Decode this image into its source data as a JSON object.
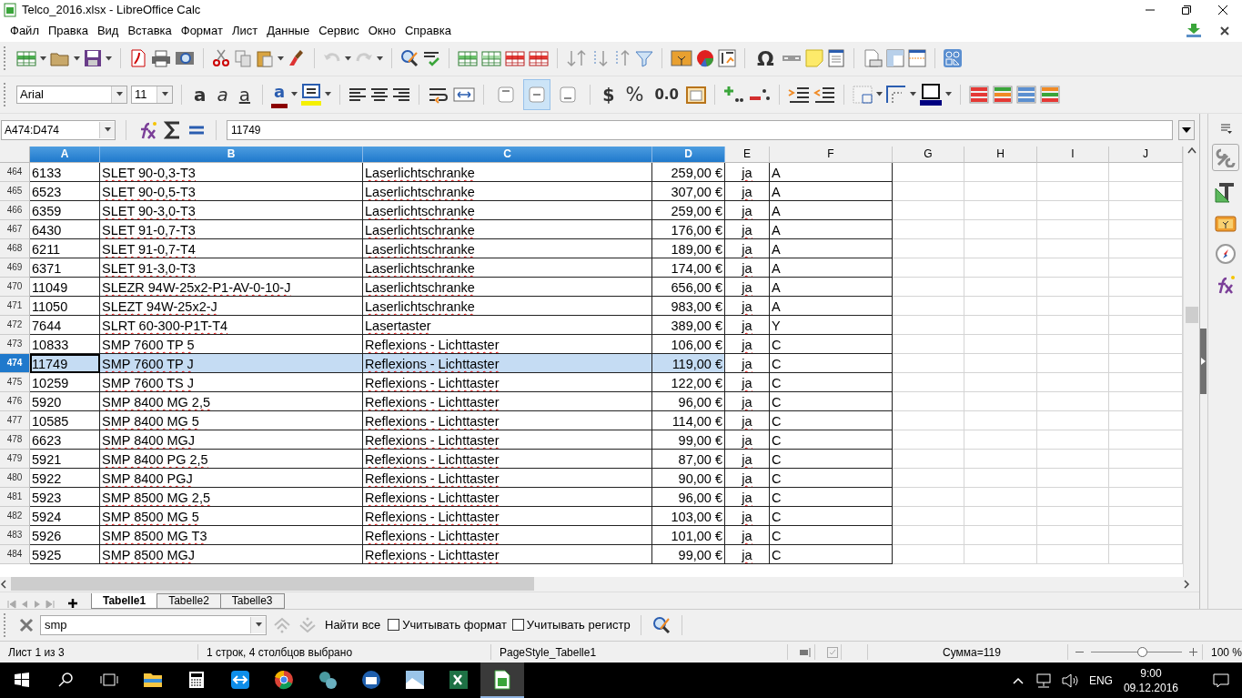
{
  "window": {
    "title": "Telco_2016.xlsx - LibreOffice Calc"
  },
  "menu": [
    "Файл",
    "Правка",
    "Вид",
    "Вставка",
    "Формат",
    "Лист",
    "Данные",
    "Сервис",
    "Окно",
    "Справка"
  ],
  "standard_toolbar": {
    "special_character": "Ω"
  },
  "formatting_toolbar": {
    "font_name": "Arial",
    "font_size": "11",
    "bold": "a",
    "italic": "a",
    "underline": "a",
    "font_color": "a",
    "vertical_align": [
      {
        "selected": false
      },
      {
        "selected": true
      },
      {
        "selected": false
      }
    ],
    "currency": "$",
    "percent": "%",
    "number": "0.0"
  },
  "formula_bar": {
    "name_box": "A474:D474",
    "value": "11749"
  },
  "sheet": {
    "columns": [
      {
        "label": "A",
        "selected": true
      },
      {
        "label": "B",
        "selected": true
      },
      {
        "label": "C",
        "selected": true
      },
      {
        "label": "D",
        "selected": true
      },
      {
        "label": "E",
        "selected": false
      },
      {
        "label": "F",
        "selected": false
      },
      {
        "label": "G",
        "selected": false
      },
      {
        "label": "H",
        "selected": false
      },
      {
        "label": "I",
        "selected": false
      },
      {
        "label": "J",
        "selected": false
      }
    ],
    "rows": [
      {
        "number": "464",
        "selected": false,
        "cells": [
          "6133",
          "SLET 90-0,3-T3",
          "Laserlichtschranke",
          "259,00 €",
          "ja",
          "A"
        ]
      },
      {
        "number": "465",
        "selected": false,
        "cells": [
          "6523",
          "SLET 90-0,5-T3",
          "Laserlichtschranke",
          "307,00 €",
          "ja",
          "A"
        ]
      },
      {
        "number": "466",
        "selected": false,
        "cells": [
          "6359",
          "SLET 90-3,0-T3",
          "Laserlichtschranke",
          "259,00 €",
          "ja",
          "A"
        ]
      },
      {
        "number": "467",
        "selected": false,
        "cells": [
          "6430",
          "SLET 91-0,7-T3",
          "Laserlichtschranke",
          "176,00 €",
          "ja",
          "A"
        ]
      },
      {
        "number": "468",
        "selected": false,
        "cells": [
          "6211",
          "SLET 91-0,7-T4",
          "Laserlichtschranke",
          "189,00 €",
          "ja",
          "A"
        ]
      },
      {
        "number": "469",
        "selected": false,
        "cells": [
          "6371",
          "SLET 91-3,0-T3",
          "Laserlichtschranke",
          "174,00 €",
          "ja",
          "A"
        ]
      },
      {
        "number": "470",
        "selected": false,
        "cells": [
          "11049",
          "SLEZR 94W-25x2-P1-AV-0-10-J",
          "Laserlichtschranke",
          "656,00 €",
          "ja",
          "A"
        ]
      },
      {
        "number": "471",
        "selected": false,
        "cells": [
          "11050",
          "SLEZT 94W-25x2-J",
          "Laserlichtschranke",
          "983,00 €",
          "ja",
          "A"
        ]
      },
      {
        "number": "472",
        "selected": false,
        "cells": [
          "7644",
          "SLRT 60-300-P1T-T4",
          "Lasertaster",
          "389,00 €",
          "ja",
          "Y"
        ]
      },
      {
        "number": "473",
        "selected": false,
        "cells": [
          "10833",
          "SMP 7600 TP 5",
          "Reflexions - Lichttaster",
          "106,00 €",
          "ja",
          "C"
        ]
      },
      {
        "number": "474",
        "selected": true,
        "cells": [
          "11749",
          "SMP 7600 TP J",
          "Reflexions - Lichttaster",
          "119,00 €",
          "ja",
          "C"
        ]
      },
      {
        "number": "475",
        "selected": false,
        "cells": [
          "10259",
          "SMP 7600 TS J",
          "Reflexions - Lichttaster",
          "122,00 €",
          "ja",
          "C"
        ]
      },
      {
        "number": "476",
        "selected": false,
        "cells": [
          "5920",
          "SMP 8400 MG 2,5",
          "Reflexions - Lichttaster",
          "96,00 €",
          "ja",
          "C"
        ]
      },
      {
        "number": "477",
        "selected": false,
        "cells": [
          "10585",
          "SMP 8400 MG 5",
          "Reflexions - Lichttaster",
          "114,00 €",
          "ja",
          "C"
        ]
      },
      {
        "number": "478",
        "selected": false,
        "cells": [
          "6623",
          "SMP 8400 MGJ",
          "Reflexions - Lichttaster",
          "99,00 €",
          "ja",
          "C"
        ]
      },
      {
        "number": "479",
        "selected": false,
        "cells": [
          "5921",
          "SMP 8400 PG 2,5",
          "Reflexions - Lichttaster",
          "87,00 €",
          "ja",
          "C"
        ]
      },
      {
        "number": "480",
        "selected": false,
        "cells": [
          "5922",
          "SMP 8400 PGJ",
          "Reflexions - Lichttaster",
          "90,00 €",
          "ja",
          "C"
        ]
      },
      {
        "number": "481",
        "selected": false,
        "cells": [
          "5923",
          "SMP 8500 MG 2,5",
          "Reflexions - Lichttaster",
          "96,00 €",
          "ja",
          "C"
        ]
      },
      {
        "number": "482",
        "selected": false,
        "cells": [
          "5924",
          "SMP 8500 MG 5",
          "Reflexions - Lichttaster",
          "103,00 €",
          "ja",
          "C"
        ]
      },
      {
        "number": "483",
        "selected": false,
        "cells": [
          "5926",
          "SMP 8500 MG T3",
          "Reflexions - Lichttaster",
          "101,00 €",
          "ja",
          "C"
        ]
      },
      {
        "number": "484",
        "selected": false,
        "cells": [
          "5925",
          "SMP 8500 MGJ",
          "Reflexions - Lichttaster",
          "99,00 €",
          "ja",
          "C"
        ]
      }
    ]
  },
  "sheet_tabs": [
    {
      "label": "Tabelle1",
      "selected": true
    },
    {
      "label": "Tabelle2",
      "selected": false
    },
    {
      "label": "Tabelle3",
      "selected": false
    }
  ],
  "find_toolbar": {
    "value": "smp",
    "find_all": "Найти все",
    "options": [
      {
        "label": "Учитывать формат",
        "checked": false
      },
      {
        "label": "Учитывать регистр",
        "checked": false
      }
    ]
  },
  "status_bar": {
    "sheet": "Лист 1 из 3",
    "selection": "1 строк, 4 столбцов выбрано",
    "page_style": "PageStyle_Tabelle1",
    "sum": "Сумма=119",
    "zoom": {
      "level": 0.56,
      "reading": "100 %"
    }
  },
  "taskbar": {
    "apps": [
      {
        "selected": false
      },
      {
        "selected": false
      },
      {
        "selected": false
      },
      {
        "selected": false
      },
      {
        "selected": false
      },
      {
        "selected": false
      },
      {
        "selected": false
      },
      {
        "selected": false
      },
      {
        "selected": false
      },
      {
        "selected": false
      },
      {
        "selected": false
      },
      {
        "selected": true
      }
    ],
    "language": "ENG",
    "time": "9:00",
    "date": "09.12.2016"
  }
}
